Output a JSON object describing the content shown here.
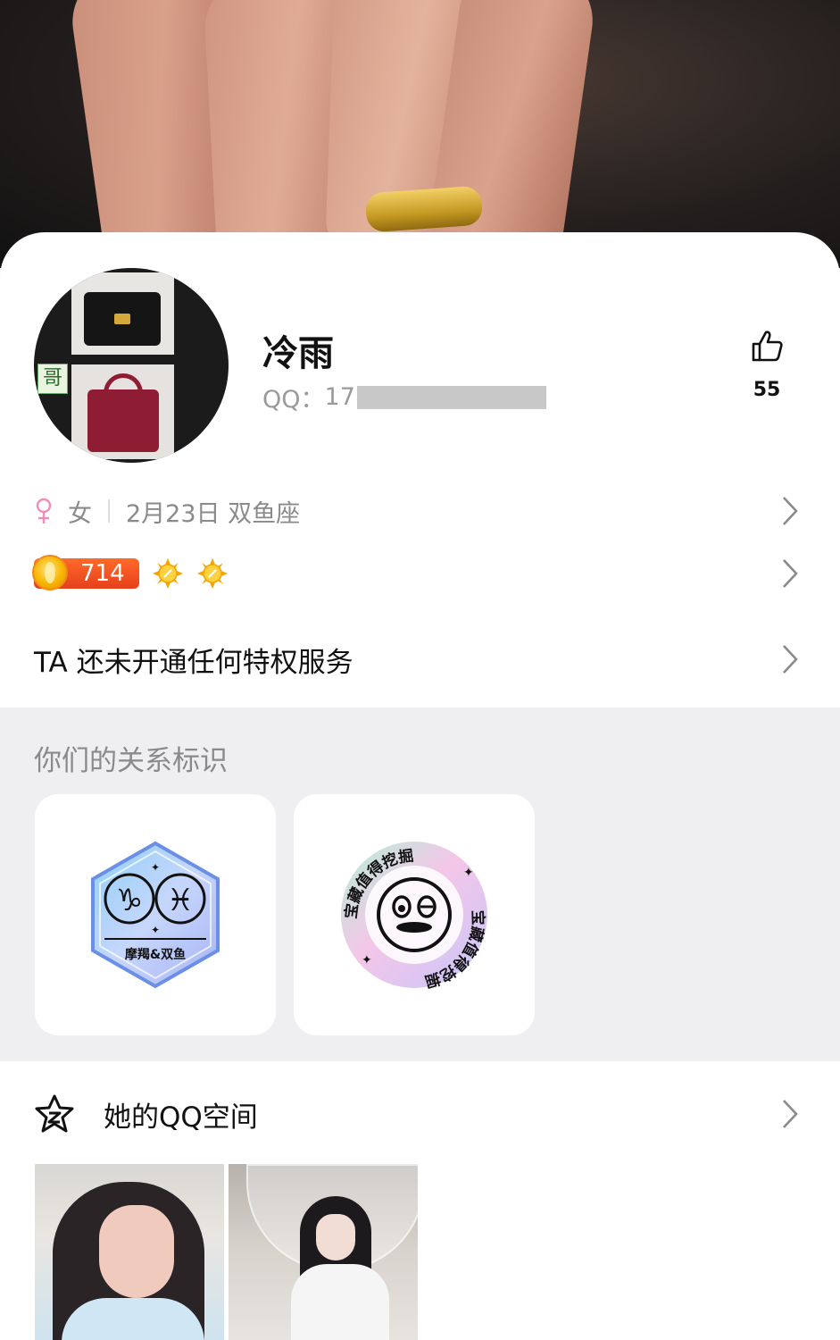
{
  "profile": {
    "name": "冷雨",
    "qq_label": "QQ：",
    "qq_prefix": "17",
    "avatar_badge_char": "哥",
    "likes": "55"
  },
  "info": {
    "gender": "女",
    "birthday_sign": "2月23日 双鱼座"
  },
  "level": {
    "value": "714"
  },
  "privilege": {
    "text": "TA 还未开通任何特权服务"
  },
  "relation": {
    "title": "你们的关系标识",
    "badges": [
      {
        "icon": "zodiac-capricorn-pisces-badge",
        "label": "摩羯&双鱼"
      },
      {
        "icon": "treasure-badge",
        "label_top": "宝藏值得挖掘",
        "label_bottom": "宝藏值得挖掘"
      }
    ]
  },
  "qzone": {
    "title": "她的QQ空间"
  },
  "colors": {
    "accent_orange": "#e5401b",
    "female_pink": "#f18bb7",
    "muted_text": "#8a8a8a",
    "section_bg": "#efeff2"
  }
}
